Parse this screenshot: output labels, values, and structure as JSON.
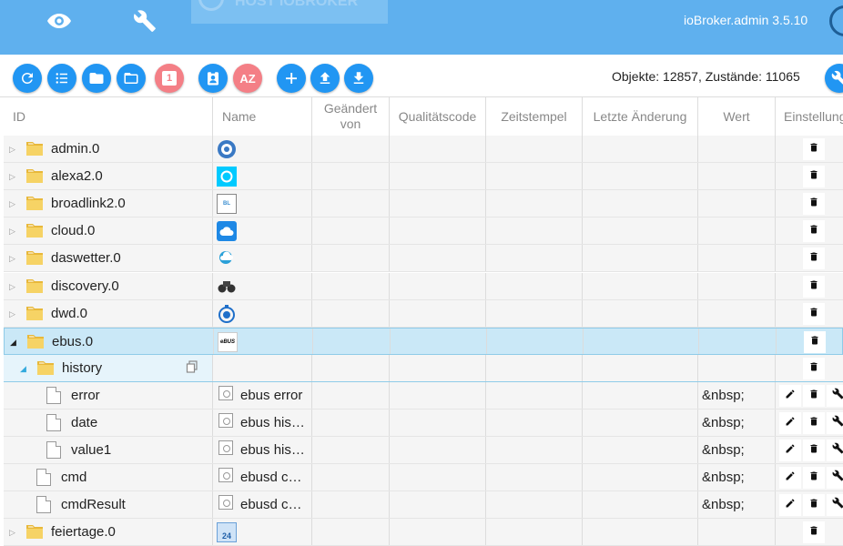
{
  "appbar": {
    "host_tab": "HOST IOBROKER",
    "version": "ioBroker.admin 3.5.10",
    "nav_icons": [
      "eye-icon",
      "wrench-icon"
    ]
  },
  "toolbar": {
    "buttons": [
      "refresh-icon",
      "list-icon",
      "folder-closed-icon",
      "folder-open-icon",
      "calendar-icon",
      "user-badge-icon",
      "sort-az-icon",
      "add-icon",
      "upload-icon",
      "download-icon"
    ],
    "calendar_label": "1",
    "sort_label": "AZ",
    "counts": "Objekte: 12857, Zustände: 11065"
  },
  "table": {
    "columns": {
      "id": "ID",
      "name": "Name",
      "changed_by_1": "Geändert",
      "changed_by_2": "von",
      "quality": "Qualitätscode",
      "timestamp": "Zeitstempel",
      "last_change": "Letzte Änderung",
      "value": "Wert",
      "settings": "Einstellungen"
    },
    "rows": [
      {
        "id": "admin.0",
        "name": "",
        "value": ""
      },
      {
        "id": "alexa2.0",
        "name": "",
        "value": ""
      },
      {
        "id": "broadlink2.0",
        "name": "",
        "value": ""
      },
      {
        "id": "cloud.0",
        "name": "",
        "value": ""
      },
      {
        "id": "daswetter.0",
        "name": "",
        "value": ""
      },
      {
        "id": "discovery.0",
        "name": "",
        "value": ""
      },
      {
        "id": "dwd.0",
        "name": "",
        "value": ""
      },
      {
        "id": "ebus.0",
        "name": "",
        "value": ""
      },
      {
        "id": "history",
        "name": "",
        "value": ""
      },
      {
        "id": "error",
        "name": "ebus error",
        "value": "&nbsp;"
      },
      {
        "id": "date",
        "name": "ebus his…",
        "value": "&nbsp;"
      },
      {
        "id": "value1",
        "name": "ebus his…",
        "value": "&nbsp;"
      },
      {
        "id": "cmd",
        "name": "ebusd c…",
        "value": "&nbsp;"
      },
      {
        "id": "cmdResult",
        "name": "ebusd c…",
        "value": "&nbsp;"
      },
      {
        "id": "feiertage.0",
        "name": "",
        "value": ""
      }
    ],
    "feiertage_icon_text": "24"
  },
  "colors": {
    "appbar": "#5fb0ee",
    "button": "#2196f3",
    "button_red": "#f47f86",
    "selected_row": "#cae8f7",
    "folder": "#f2c94c"
  }
}
